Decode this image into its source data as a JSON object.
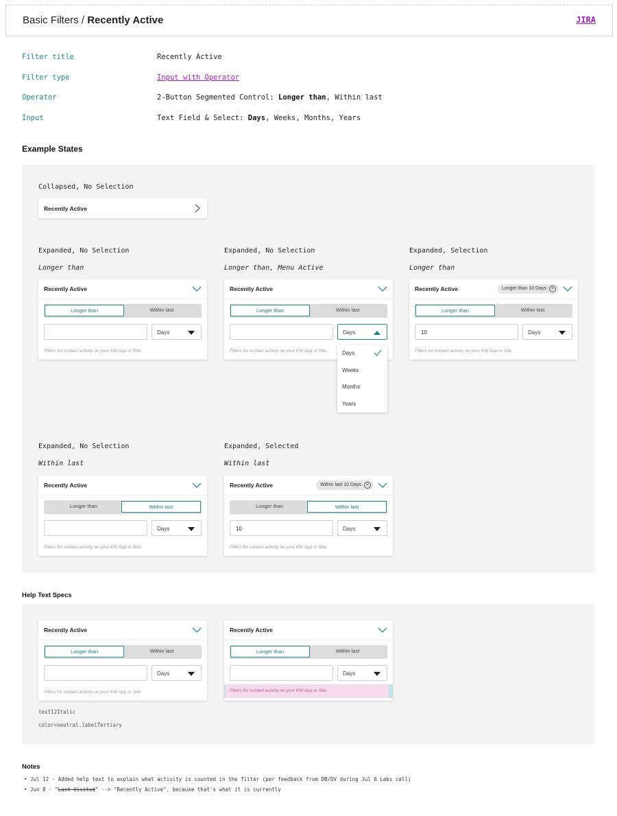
{
  "header": {
    "breadcrumb_parent": "Basic Filters /",
    "breadcrumb_current": "Recently Active",
    "jira_link": "JIRA"
  },
  "spec": {
    "filter_title_key": "Filter title",
    "filter_title_val": "Recently Active",
    "filter_type_key": "Filter type",
    "filter_type_val": "Input with Operator",
    "operator_key": "Operator",
    "operator_prefix": "2-Button Segmented Control: ",
    "operator_bold": "Longer than",
    "operator_rest": ", Within last",
    "input_key": "Input",
    "input_prefix": "Text Field & Select: ",
    "input_bold": "Days",
    "input_rest": ", Weeks, Months, Years"
  },
  "example_states": {
    "title": "Example States",
    "collapsed_caption": "Collapsed, No Selection",
    "collapsed_title": "Recently Active",
    "states": [
      {
        "caption": "Expanded, No Selection",
        "sub": "Longer than"
      },
      {
        "caption": "Expanded, No Selection",
        "sub": "Longer than, Menu Active"
      },
      {
        "caption": "Expanded, Selection",
        "sub": "Longer than"
      },
      {
        "caption": "Expanded, No Selection",
        "sub": "Within last"
      },
      {
        "caption": "Expanded, Selected",
        "sub": "Within last"
      }
    ]
  },
  "card": {
    "title": "Recently Active",
    "seg_left": "Longer than",
    "seg_right": "Within last",
    "select_value": "Days",
    "help": "Filters for contact activity on your KW App or Site.",
    "input_value": "10",
    "chip_longer": "Longer than 10 Days",
    "chip_within": "Within last 10 Days"
  },
  "dropdown": {
    "options": [
      "Days",
      "Weeks",
      "Months",
      "Years"
    ],
    "selected": "Days"
  },
  "help_specs": {
    "title": "Help Text Specs",
    "style_token": "text12Italic",
    "color_token": "color=neutral.labelTertiary"
  },
  "notes": {
    "title": "Notes",
    "line1": "• Jul 12 - Added help text to explain what activity is counted in the filter (per feedback from DB/DV during Jul 6 Labs call)",
    "line2_prefix": "• Jun 8 - \"",
    "line2_struck": "Last Visited",
    "line2_suffix": "\" --> \"Recently Active\", because that's what it is currently"
  },
  "colors": {
    "accent_teal": "#2a8a96",
    "link_purple": "#a020c0",
    "panel_bg": "#f4f4f4",
    "help_highlight": "#f6dbeb"
  },
  "icons": [
    "chevron-down-icon",
    "chevron-right-icon",
    "caret-down-icon",
    "caret-up-icon",
    "check-icon",
    "clear-chip-icon"
  ]
}
